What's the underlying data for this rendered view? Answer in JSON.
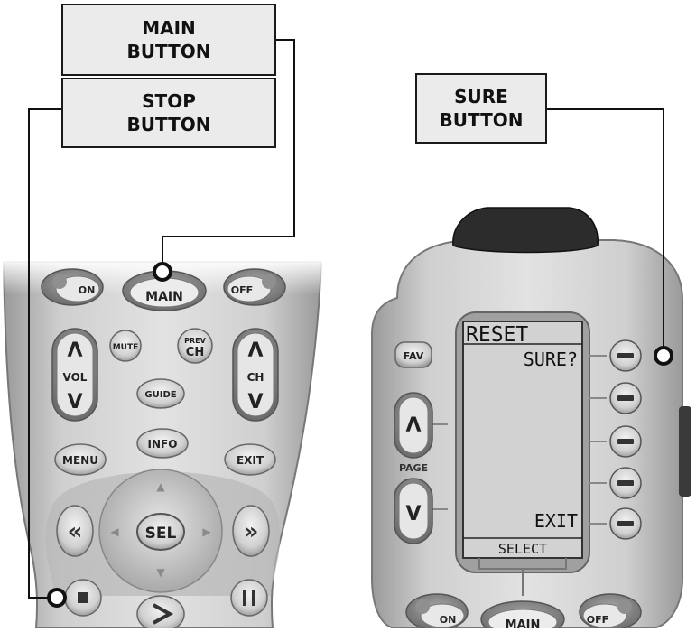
{
  "callouts": {
    "main": "MAIN\nBUTTON",
    "stop": "STOP\nBUTTON",
    "sure": "SURE\nBUTTON"
  },
  "left_remote": {
    "on": "ON",
    "main": "MAIN",
    "off": "OFF",
    "vol": "VOL",
    "mute": "MUTE",
    "prev": "PREV",
    "ch_small": "CH",
    "ch": "CH",
    "guide": "GUIDE",
    "menu": "MENU",
    "info": "INFO",
    "exit": "EXIT",
    "sel": "SEL",
    "rewind": "«",
    "fast_forward": "»",
    "stop_icon": "stop-icon",
    "play_icon": "play-icon",
    "pause_icon": "pause-icon"
  },
  "right_remote": {
    "fav": "FAV",
    "page": "PAGE",
    "screen_title": "RESET",
    "screen_prompt": "SURE?",
    "screen_exit": "EXIT",
    "screen_select": "SELECT",
    "on": "ON",
    "main": "MAIN",
    "off": "OFF"
  },
  "colors": {
    "remote_body": "#c8c8c8",
    "button": "#d6d6d6",
    "button_dark": "#8a8a8a",
    "screen": "#cfcfcf",
    "cap": "#2a2a2a",
    "callout_fill": "#ebebeb"
  }
}
